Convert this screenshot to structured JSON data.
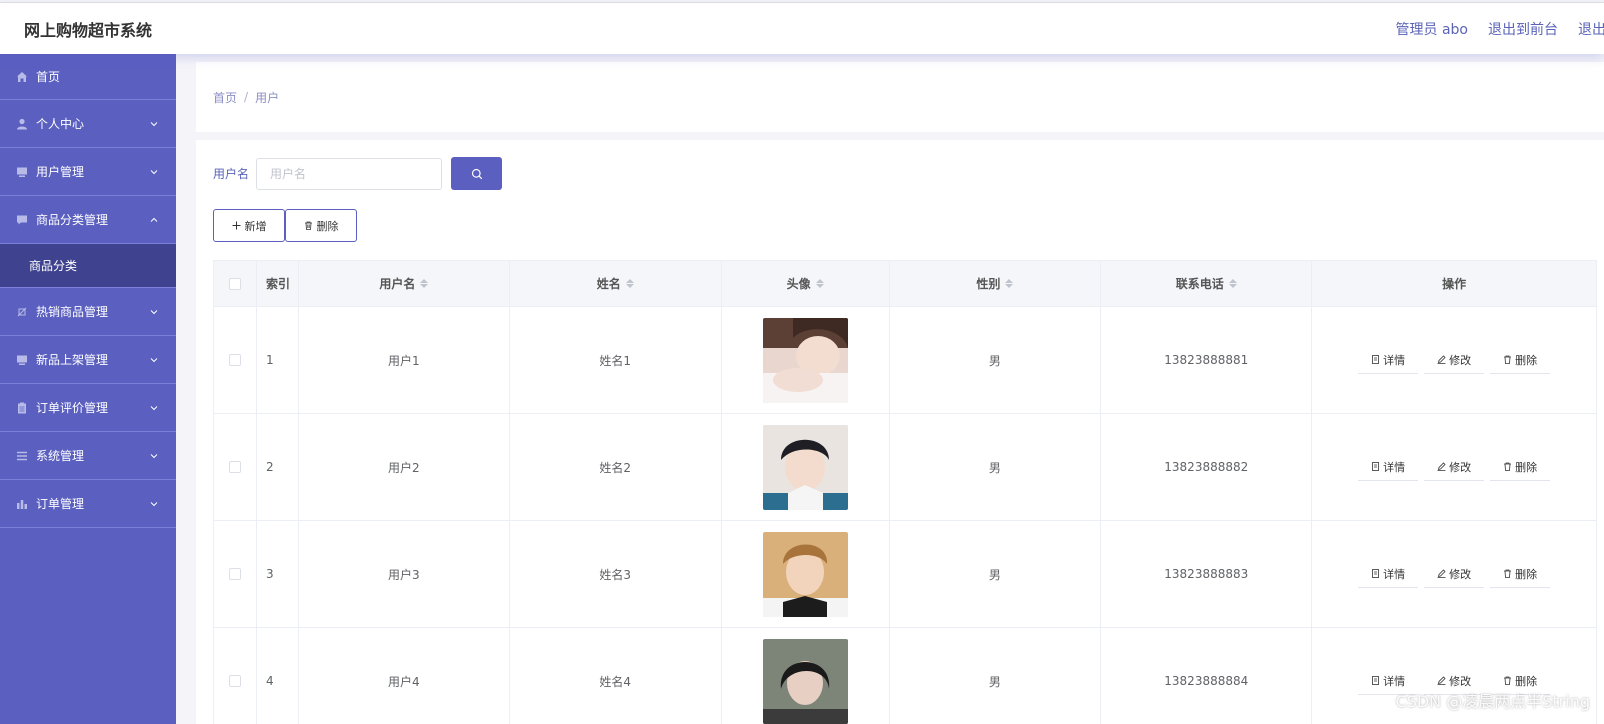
{
  "header": {
    "title": "网上购物超市系统",
    "admin": "管理员 abo",
    "front_link": "退出到前台",
    "logout": "退出登录"
  },
  "sidebar": {
    "items": [
      {
        "label": "首页",
        "icon": "home-icon"
      },
      {
        "label": "个人中心",
        "icon": "user-icon"
      },
      {
        "label": "用户管理",
        "icon": "monitor-icon"
      },
      {
        "label": "商品分类管理",
        "icon": "message-icon",
        "expanded": true,
        "sub": "商品分类"
      },
      {
        "label": "热销商品管理",
        "icon": "tag-icon"
      },
      {
        "label": "新品上架管理",
        "icon": "monitor-icon"
      },
      {
        "label": "订单评价管理",
        "icon": "clipboard-icon"
      },
      {
        "label": "系统管理",
        "icon": "menu-icon"
      },
      {
        "label": "订单管理",
        "icon": "chart-icon"
      }
    ]
  },
  "breadcrumb": {
    "home": "首页",
    "sep": "/",
    "current": "用户"
  },
  "search": {
    "label": "用户名",
    "placeholder": "用户名",
    "value": ""
  },
  "actions": {
    "add": "新增",
    "delete": "删除"
  },
  "table": {
    "headers": {
      "index": "索引",
      "username": "用户名",
      "name": "姓名",
      "avatar": "头像",
      "gender": "性别",
      "phone": "联系电话",
      "op": "操作"
    },
    "rows": [
      {
        "index": "1",
        "username": "用户1",
        "name": "姓名1",
        "gender": "男",
        "phone": "13823888881"
      },
      {
        "index": "2",
        "username": "用户2",
        "name": "姓名2",
        "gender": "男",
        "phone": "13823888882"
      },
      {
        "index": "3",
        "username": "用户3",
        "name": "姓名3",
        "gender": "男",
        "phone": "13823888883"
      },
      {
        "index": "4",
        "username": "用户4",
        "name": "姓名4",
        "gender": "男",
        "phone": "13823888884"
      }
    ],
    "op_labels": {
      "detail": "详情",
      "edit": "修改",
      "remove": "删除"
    }
  },
  "watermark": "CSDN @凌晨两点半String",
  "colors": {
    "sidebar": "#5a5fc0",
    "sidebar_active": "#3f438f",
    "accent": "#5a63b8"
  }
}
